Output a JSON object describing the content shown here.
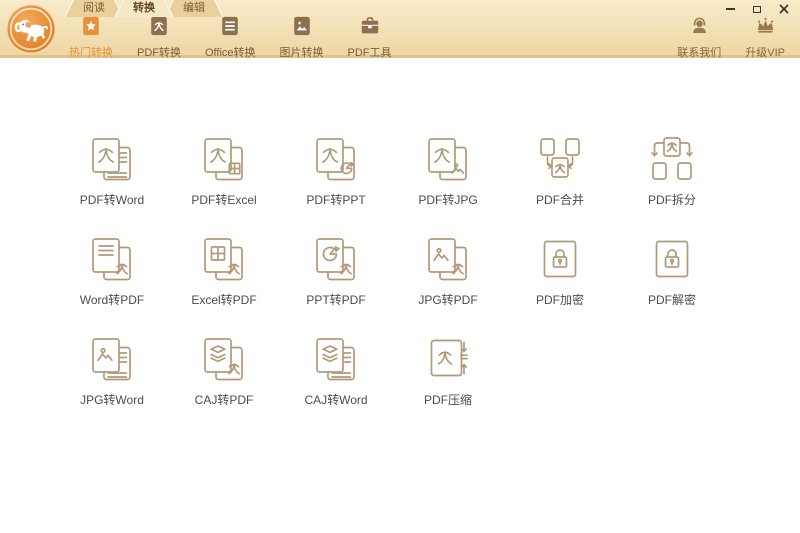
{
  "window": {
    "controls": [
      {
        "name": "minimize"
      },
      {
        "name": "maximize"
      },
      {
        "name": "close"
      }
    ]
  },
  "tabs": [
    {
      "label": "阅读",
      "name": "read",
      "active": false
    },
    {
      "label": "转换",
      "name": "convert",
      "active": true
    },
    {
      "label": "编辑",
      "name": "edit",
      "active": false
    }
  ],
  "toolbar": {
    "items": [
      {
        "label": "热门转换",
        "name": "hot-convert",
        "icon": "star-doc-icon",
        "active": true
      },
      {
        "label": "PDF转换",
        "name": "pdf-convert",
        "icon": "pdf-doc-icon",
        "active": false
      },
      {
        "label": "Office转换",
        "name": "office-convert",
        "icon": "office-doc-icon",
        "active": false
      },
      {
        "label": "图片转换",
        "name": "image-convert",
        "icon": "image-doc-icon",
        "active": false
      },
      {
        "label": "PDF工具",
        "name": "pdf-tools",
        "icon": "toolbox-icon",
        "active": false
      }
    ]
  },
  "header_right": [
    {
      "label": "联系我们",
      "name": "contact-us",
      "icon": "headset-person-icon"
    },
    {
      "label": "升级VIP",
      "name": "upgrade-vip",
      "icon": "crown-icon"
    }
  ],
  "grid": {
    "items": [
      {
        "label": "PDF转Word",
        "icon": "pdf-to-word"
      },
      {
        "label": "PDF转Excel",
        "icon": "pdf-to-excel"
      },
      {
        "label": "PDF转PPT",
        "icon": "pdf-to-ppt"
      },
      {
        "label": "PDF转JPG",
        "icon": "pdf-to-jpg"
      },
      {
        "label": "PDF合并",
        "icon": "pdf-merge"
      },
      {
        "label": "PDF拆分",
        "icon": "pdf-split"
      },
      {
        "label": "Word转PDF",
        "icon": "word-to-pdf"
      },
      {
        "label": "Excel转PDF",
        "icon": "excel-to-pdf"
      },
      {
        "label": "PPT转PDF",
        "icon": "ppt-to-pdf"
      },
      {
        "label": "JPG转PDF",
        "icon": "jpg-to-pdf"
      },
      {
        "label": "PDF加密",
        "icon": "pdf-encrypt"
      },
      {
        "label": "PDF解密",
        "icon": "pdf-decrypt"
      },
      {
        "label": "JPG转Word",
        "icon": "jpg-to-word"
      },
      {
        "label": "CAJ转PDF",
        "icon": "caj-to-pdf"
      },
      {
        "label": "CAJ转Word",
        "icon": "caj-to-word"
      },
      {
        "label": "PDF压缩",
        "icon": "pdf-compress"
      }
    ]
  },
  "colors": {
    "accent_orange": "#e8913c",
    "brand_brown": "#8d7050",
    "header_right_brown": "#9a7b51",
    "header_top": "#f8ebca",
    "header_bottom": "#eed7a5",
    "header_border": "#e1c389",
    "tab_inactive_bg": "#ead09b",
    "tab_active_bg": "#f6e9c7",
    "grid_icon_stroke": "#b29a79",
    "grid_label_gray": "#4c4c4c",
    "window_control_color": "#3e3529",
    "logo_orange": "#e1832a"
  }
}
